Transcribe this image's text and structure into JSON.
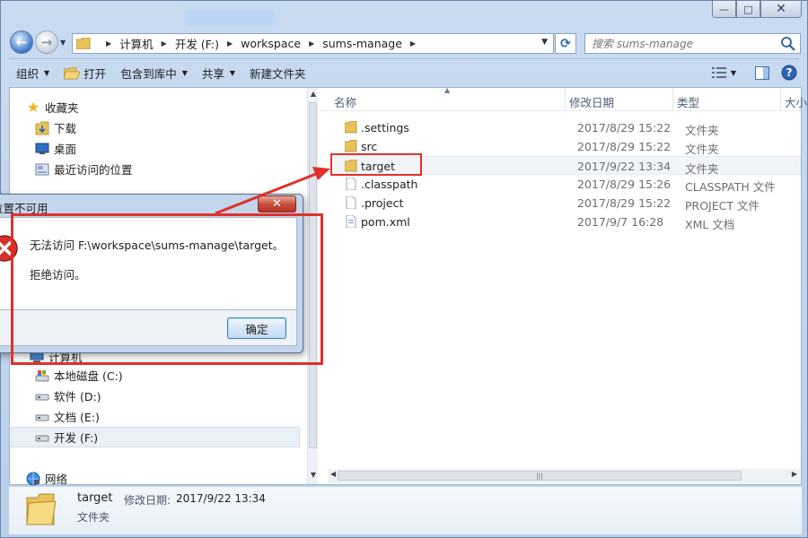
{
  "window": {
    "caption_buttons": {
      "minimize": "—",
      "maximize": "□",
      "close": "✕"
    }
  },
  "address": {
    "crumbs": [
      "计算机",
      "开发 (F:)",
      "workspace",
      "sums-manage"
    ],
    "search_placeholder": "搜索 sums-manage"
  },
  "toolbar": {
    "organize": "组织",
    "open": "打开",
    "include_in_library": "包含到库中",
    "share": "共享",
    "new_folder": "新建文件夹"
  },
  "navpane": {
    "favorites": "收藏夹",
    "downloads": "下载",
    "desktop": "桌面",
    "recent": "最近访问的位置",
    "computer": "计算机",
    "drives": [
      "本地磁盘 (C:)",
      "软件 (D:)",
      "文档 (E:)",
      "开发 (F:)"
    ],
    "network": "网络"
  },
  "columns": {
    "name": "名称",
    "modified": "修改日期",
    "type": "类型",
    "size": "大小"
  },
  "files": [
    {
      "name": ".settings",
      "modified": "2017/8/29 15:22",
      "type": "文件夹",
      "kind": "folder"
    },
    {
      "name": "src",
      "modified": "2017/8/29 15:22",
      "type": "文件夹",
      "kind": "folder"
    },
    {
      "name": "target",
      "modified": "2017/9/22 13:34",
      "type": "文件夹",
      "kind": "folder"
    },
    {
      "name": ".classpath",
      "modified": "2017/8/29 15:26",
      "type": "CLASSPATH 文件",
      "kind": "file"
    },
    {
      "name": ".project",
      "modified": "2017/8/29 15:22",
      "type": "PROJECT 文件",
      "kind": "file"
    },
    {
      "name": "pom.xml",
      "modified": "2017/9/7 16:28",
      "type": "XML 文档",
      "kind": "xml"
    }
  ],
  "details": {
    "name": "target",
    "modified_label": "修改日期:",
    "modified": "2017/9/22 13:34",
    "type": "文件夹"
  },
  "dialog": {
    "title": "位置不可用",
    "close": "✕",
    "message": "无法访问 F:\\workspace\\sums-manage\\target。",
    "sub": "拒绝访问。",
    "ok": "确定"
  },
  "colors": {
    "annotation": "#e0302b",
    "folder": "#e8c25a",
    "accent": "#2c62b2"
  }
}
